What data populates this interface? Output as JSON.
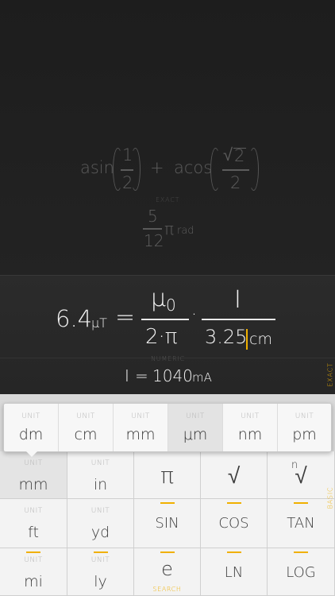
{
  "history": {
    "expression": {
      "asin": "asin",
      "frac1_num": "1",
      "frac1_den": "2",
      "plus": "+",
      "acos": "acos",
      "sqrt_symbol": "√",
      "sqrt_arg": "2",
      "frac2_den": "2"
    },
    "mode_label": "EXACT",
    "result": {
      "num": "5",
      "den": "12",
      "pi": "π",
      "unit": "rad"
    }
  },
  "current": {
    "lhs_value": "6.4",
    "lhs_unit": "μT",
    "equals": "=",
    "numerator1": "μ",
    "numerator1_sub": "0",
    "denominator1": "2·π",
    "dot": "·",
    "numerator2": "I",
    "denominator2_value": "3.25",
    "denominator2_unit": "cm",
    "mode_label": "NUMERIC",
    "result_var": "I",
    "result_equals": "=",
    "result_value": "1040",
    "result_unit": "mA",
    "side_toggle": "EXACT"
  },
  "popup": {
    "caption": "UNIT",
    "units": [
      "dm",
      "cm",
      "mm",
      "μm",
      "nm",
      "pm"
    ],
    "selected_index": 3
  },
  "keyboard": {
    "unit_caption": "UNIT",
    "rows": [
      {
        "k1": "mm",
        "k2": "in",
        "k3": "π",
        "k4": "√",
        "k5": "√",
        "k5_index": "n"
      },
      {
        "k1": "ft",
        "k2": "yd",
        "k3": "SIN",
        "k4": "COS",
        "k5": "TAN"
      },
      {
        "k1": "mi",
        "k2": "ly",
        "k3": "e",
        "k4": "LN",
        "k5": "LOG"
      }
    ],
    "search_label": "SEARCH",
    "side_toggle": "BASIC"
  },
  "colors": {
    "accent": "#f0b000",
    "background": "#1f1f1f",
    "keyboard": "#f3f3f3"
  }
}
